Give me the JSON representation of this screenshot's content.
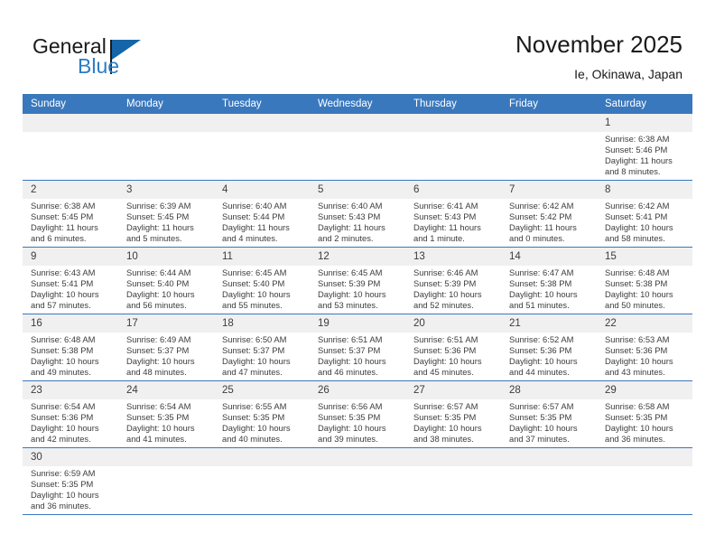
{
  "brand": {
    "name_top": "General",
    "name_bottom": "Blue",
    "accent_color": "#1466a8",
    "blue_text_color": "#2b7cc4"
  },
  "header": {
    "title": "November 2025",
    "subtitle": "Ie, Okinawa, Japan"
  },
  "theme": {
    "header_row_bg": "#3a78bd",
    "daynum_bg": "#f0f0f0",
    "text_color": "#3c3c3c",
    "grid_line": "#3a78bd"
  },
  "weekdays": [
    "Sunday",
    "Monday",
    "Tuesday",
    "Wednesday",
    "Thursday",
    "Friday",
    "Saturday"
  ],
  "weeks": [
    [
      {
        "blank": true
      },
      {
        "blank": true
      },
      {
        "blank": true
      },
      {
        "blank": true
      },
      {
        "blank": true
      },
      {
        "blank": true
      },
      {
        "day": "1",
        "sunrise": "Sunrise: 6:38 AM",
        "sunset": "Sunset: 5:46 PM",
        "daylight": "Daylight: 11 hours and 8 minutes."
      }
    ],
    [
      {
        "day": "2",
        "sunrise": "Sunrise: 6:38 AM",
        "sunset": "Sunset: 5:45 PM",
        "daylight": "Daylight: 11 hours and 6 minutes."
      },
      {
        "day": "3",
        "sunrise": "Sunrise: 6:39 AM",
        "sunset": "Sunset: 5:45 PM",
        "daylight": "Daylight: 11 hours and 5 minutes."
      },
      {
        "day": "4",
        "sunrise": "Sunrise: 6:40 AM",
        "sunset": "Sunset: 5:44 PM",
        "daylight": "Daylight: 11 hours and 4 minutes."
      },
      {
        "day": "5",
        "sunrise": "Sunrise: 6:40 AM",
        "sunset": "Sunset: 5:43 PM",
        "daylight": "Daylight: 11 hours and 2 minutes."
      },
      {
        "day": "6",
        "sunrise": "Sunrise: 6:41 AM",
        "sunset": "Sunset: 5:43 PM",
        "daylight": "Daylight: 11 hours and 1 minute."
      },
      {
        "day": "7",
        "sunrise": "Sunrise: 6:42 AM",
        "sunset": "Sunset: 5:42 PM",
        "daylight": "Daylight: 11 hours and 0 minutes."
      },
      {
        "day": "8",
        "sunrise": "Sunrise: 6:42 AM",
        "sunset": "Sunset: 5:41 PM",
        "daylight": "Daylight: 10 hours and 58 minutes."
      }
    ],
    [
      {
        "day": "9",
        "sunrise": "Sunrise: 6:43 AM",
        "sunset": "Sunset: 5:41 PM",
        "daylight": "Daylight: 10 hours and 57 minutes."
      },
      {
        "day": "10",
        "sunrise": "Sunrise: 6:44 AM",
        "sunset": "Sunset: 5:40 PM",
        "daylight": "Daylight: 10 hours and 56 minutes."
      },
      {
        "day": "11",
        "sunrise": "Sunrise: 6:45 AM",
        "sunset": "Sunset: 5:40 PM",
        "daylight": "Daylight: 10 hours and 55 minutes."
      },
      {
        "day": "12",
        "sunrise": "Sunrise: 6:45 AM",
        "sunset": "Sunset: 5:39 PM",
        "daylight": "Daylight: 10 hours and 53 minutes."
      },
      {
        "day": "13",
        "sunrise": "Sunrise: 6:46 AM",
        "sunset": "Sunset: 5:39 PM",
        "daylight": "Daylight: 10 hours and 52 minutes."
      },
      {
        "day": "14",
        "sunrise": "Sunrise: 6:47 AM",
        "sunset": "Sunset: 5:38 PM",
        "daylight": "Daylight: 10 hours and 51 minutes."
      },
      {
        "day": "15",
        "sunrise": "Sunrise: 6:48 AM",
        "sunset": "Sunset: 5:38 PM",
        "daylight": "Daylight: 10 hours and 50 minutes."
      }
    ],
    [
      {
        "day": "16",
        "sunrise": "Sunrise: 6:48 AM",
        "sunset": "Sunset: 5:38 PM",
        "daylight": "Daylight: 10 hours and 49 minutes."
      },
      {
        "day": "17",
        "sunrise": "Sunrise: 6:49 AM",
        "sunset": "Sunset: 5:37 PM",
        "daylight": "Daylight: 10 hours and 48 minutes."
      },
      {
        "day": "18",
        "sunrise": "Sunrise: 6:50 AM",
        "sunset": "Sunset: 5:37 PM",
        "daylight": "Daylight: 10 hours and 47 minutes."
      },
      {
        "day": "19",
        "sunrise": "Sunrise: 6:51 AM",
        "sunset": "Sunset: 5:37 PM",
        "daylight": "Daylight: 10 hours and 46 minutes."
      },
      {
        "day": "20",
        "sunrise": "Sunrise: 6:51 AM",
        "sunset": "Sunset: 5:36 PM",
        "daylight": "Daylight: 10 hours and 45 minutes."
      },
      {
        "day": "21",
        "sunrise": "Sunrise: 6:52 AM",
        "sunset": "Sunset: 5:36 PM",
        "daylight": "Daylight: 10 hours and 44 minutes."
      },
      {
        "day": "22",
        "sunrise": "Sunrise: 6:53 AM",
        "sunset": "Sunset: 5:36 PM",
        "daylight": "Daylight: 10 hours and 43 minutes."
      }
    ],
    [
      {
        "day": "23",
        "sunrise": "Sunrise: 6:54 AM",
        "sunset": "Sunset: 5:36 PM",
        "daylight": "Daylight: 10 hours and 42 minutes."
      },
      {
        "day": "24",
        "sunrise": "Sunrise: 6:54 AM",
        "sunset": "Sunset: 5:35 PM",
        "daylight": "Daylight: 10 hours and 41 minutes."
      },
      {
        "day": "25",
        "sunrise": "Sunrise: 6:55 AM",
        "sunset": "Sunset: 5:35 PM",
        "daylight": "Daylight: 10 hours and 40 minutes."
      },
      {
        "day": "26",
        "sunrise": "Sunrise: 6:56 AM",
        "sunset": "Sunset: 5:35 PM",
        "daylight": "Daylight: 10 hours and 39 minutes."
      },
      {
        "day": "27",
        "sunrise": "Sunrise: 6:57 AM",
        "sunset": "Sunset: 5:35 PM",
        "daylight": "Daylight: 10 hours and 38 minutes."
      },
      {
        "day": "28",
        "sunrise": "Sunrise: 6:57 AM",
        "sunset": "Sunset: 5:35 PM",
        "daylight": "Daylight: 10 hours and 37 minutes."
      },
      {
        "day": "29",
        "sunrise": "Sunrise: 6:58 AM",
        "sunset": "Sunset: 5:35 PM",
        "daylight": "Daylight: 10 hours and 36 minutes."
      }
    ],
    [
      {
        "day": "30",
        "sunrise": "Sunrise: 6:59 AM",
        "sunset": "Sunset: 5:35 PM",
        "daylight": "Daylight: 10 hours and 36 minutes."
      },
      {
        "blank": true
      },
      {
        "blank": true
      },
      {
        "blank": true
      },
      {
        "blank": true
      },
      {
        "blank": true
      },
      {
        "blank": true
      }
    ]
  ]
}
